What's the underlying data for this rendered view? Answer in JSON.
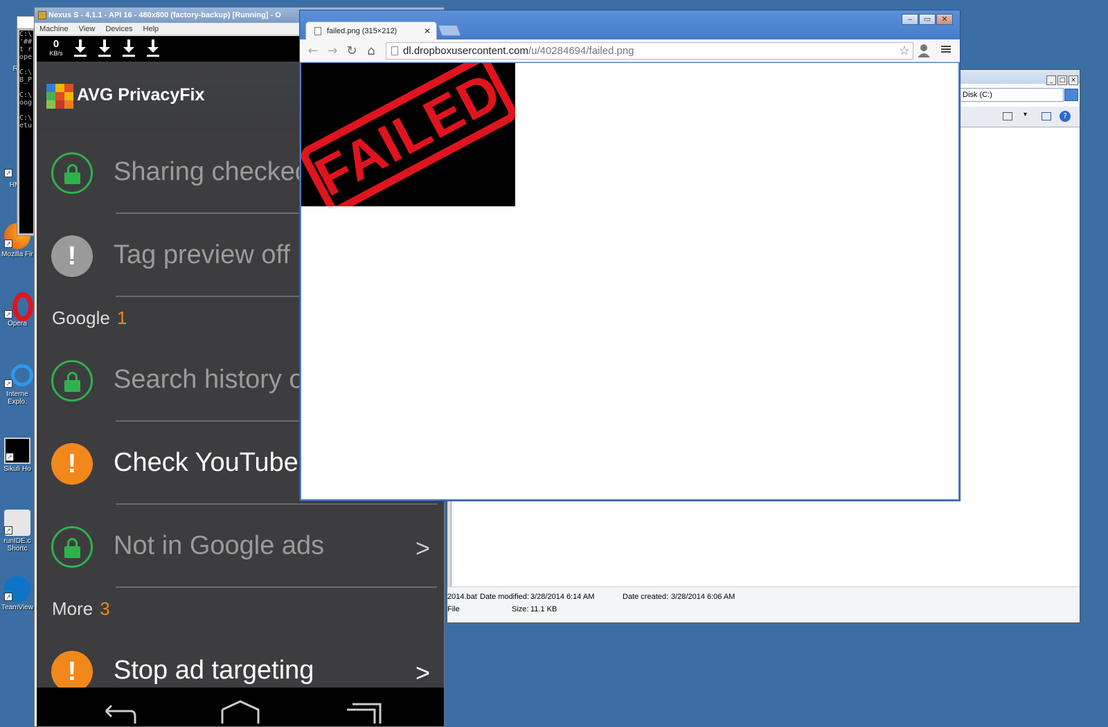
{
  "desktop": {
    "icons": [
      {
        "label": "Re"
      },
      {
        "label": "HMA"
      },
      {
        "label": "Mozilla Fir"
      },
      {
        "label": "Opera"
      },
      {
        "label": "Interne Explo."
      },
      {
        "label": "Sikuli Ho"
      },
      {
        "label": "runIDE.c Shortc"
      },
      {
        "label": "TeamView"
      }
    ]
  },
  "console": {
    "lines": "C:\\\n'##\nt r\nope\n\nC:\\\nB_P\n\nC:\\\noog\n\nC:\\\netu"
  },
  "emulator": {
    "title": "Nexus S - 4.1.1 - API 16 - 480x800 (factory-backup) [Running] - O",
    "menu": [
      "Machine",
      "View",
      "Devices",
      "Help"
    ],
    "statusbar": {
      "speed_value": "0",
      "speed_unit": "KB/s"
    },
    "app": {
      "title": "AVG PrivacyFix",
      "items": [
        {
          "label": "Sharing checked",
          "status": "ok"
        },
        {
          "label": "Tag preview off",
          "status": "neutral"
        }
      ],
      "sections": [
        {
          "name": "Google",
          "count": "1"
        },
        {
          "name": "More",
          "count": "3"
        }
      ],
      "google_items": [
        {
          "label": "Search history o",
          "status": "ok"
        },
        {
          "label": "Check YouTube",
          "status": "warning"
        },
        {
          "label": "Not in Google ads",
          "status": "ok",
          "chevron": ">"
        }
      ],
      "more_items": [
        {
          "label": "Stop ad targeting",
          "status": "warning",
          "chevron": ">"
        }
      ]
    }
  },
  "explorer": {
    "address": "Disk (C:)",
    "details": {
      "filename": "2014.bat",
      "modified_label": "Date modified:",
      "modified_value": "3/28/2014 6:14 AM",
      "created_label": "Date created:",
      "created_value": "3/28/2014 6:06 AM",
      "type": "File",
      "size_label": "Size:",
      "size_value": "11.1 KB"
    }
  },
  "browser": {
    "tab_title": "failed.png (315×212)",
    "url_host": "dl.dropboxusercontent.com",
    "url_path": "/u/40284694/failed.png",
    "image_text": "FAILED",
    "colors": {
      "stamp": "#e0141e",
      "titlebar": "#4a7fc8"
    }
  }
}
